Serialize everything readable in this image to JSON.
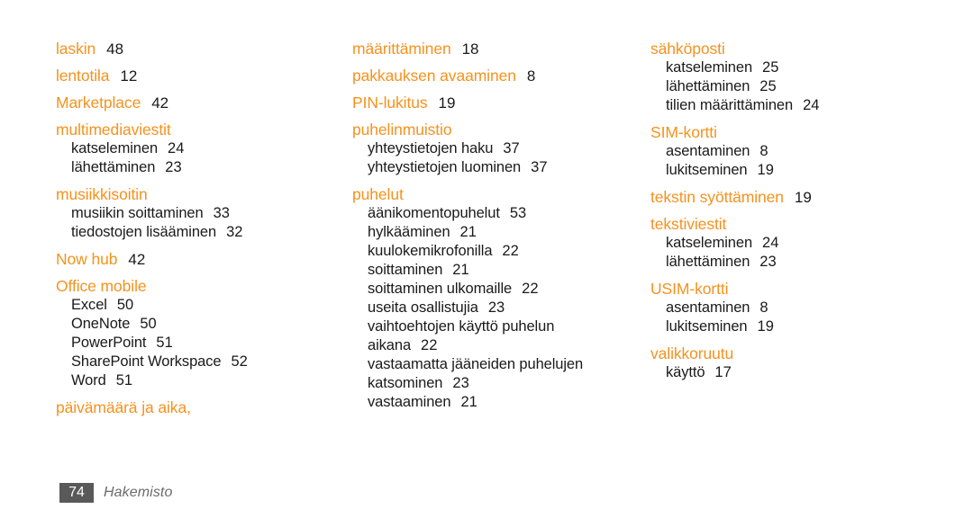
{
  "document": {
    "footer": {
      "page_number": "74",
      "section_label": "Hakemisto"
    },
    "accent_color": "#f5921e",
    "text_color": "#1a1a1a",
    "footer_box_color": "#595959"
  },
  "columns": [
    {
      "id": "column-1",
      "groups": [
        {
          "heading": "laskin",
          "heading_page": "48",
          "sub_entries": []
        },
        {
          "heading": "lentotila",
          "heading_page": "12",
          "sub_entries": []
        },
        {
          "heading": "Marketplace",
          "heading_page": "42",
          "sub_entries": []
        },
        {
          "heading": "multimediaviestit",
          "heading_page": "",
          "sub_entries": [
            {
              "label": "katseleminen",
              "page": "24"
            },
            {
              "label": "lähettäminen",
              "page": "23"
            }
          ]
        },
        {
          "heading": "musiikkisoitin",
          "heading_page": "",
          "sub_entries": [
            {
              "label": "musiikin soittaminen",
              "page": "33"
            },
            {
              "label": "tiedostojen lisääminen",
              "page": "32"
            }
          ]
        },
        {
          "heading": "Now hub",
          "heading_page": "42",
          "sub_entries": []
        },
        {
          "heading": "Office mobile",
          "heading_page": "",
          "sub_entries": [
            {
              "label": "Excel",
              "page": "50"
            },
            {
              "label": "OneNote",
              "page": "50"
            },
            {
              "label": "PowerPoint",
              "page": "51"
            },
            {
              "label": "SharePoint Workspace",
              "page": "52"
            },
            {
              "label": "Word",
              "page": "51"
            }
          ]
        },
        {
          "heading": "päivämäärä ja aika,",
          "heading_page": "",
          "sub_entries": []
        }
      ]
    },
    {
      "id": "column-2",
      "groups": [
        {
          "heading": "määrittäminen",
          "heading_page": "18",
          "sub_entries": []
        },
        {
          "heading": "pakkauksen avaaminen",
          "heading_page": "8",
          "sub_entries": []
        },
        {
          "heading": "PIN-lukitus",
          "heading_page": "19",
          "sub_entries": []
        },
        {
          "heading": "puhelinmuistio",
          "heading_page": "",
          "sub_entries": [
            {
              "label": "yhteystietojen haku",
              "page": "37"
            },
            {
              "label": "yhteystietojen luominen",
              "page": "37"
            }
          ]
        },
        {
          "heading": "puhelut",
          "heading_page": "",
          "sub_entries": [
            {
              "label": "äänikomentopuhelut",
              "page": "53"
            },
            {
              "label": "hylkääminen",
              "page": "21"
            },
            {
              "label": "kuulokemikrofonilla",
              "page": "22"
            },
            {
              "label": "soittaminen",
              "page": "21"
            },
            {
              "label": "soittaminen ulkomaille",
              "page": "22"
            },
            {
              "label": "useita osallistujia",
              "page": "23"
            },
            {
              "label": "vaihtoehtojen käyttö puhelun aikana",
              "page": "22",
              "wrapped": true
            },
            {
              "label": "vastaamatta jääneiden puhelujen katsominen",
              "page": "23",
              "wrapped": true
            },
            {
              "label": "vastaaminen",
              "page": "21"
            }
          ]
        }
      ]
    },
    {
      "id": "column-3",
      "groups": [
        {
          "heading": "sähköposti",
          "heading_page": "",
          "sub_entries": [
            {
              "label": "katseleminen",
              "page": "25"
            },
            {
              "label": "lähettäminen",
              "page": "25"
            },
            {
              "label": "tilien määrittäminen",
              "page": "24"
            }
          ]
        },
        {
          "heading": "SIM-kortti",
          "heading_page": "",
          "sub_entries": [
            {
              "label": "asentaminen",
              "page": "8"
            },
            {
              "label": "lukitseminen",
              "page": "19"
            }
          ]
        },
        {
          "heading": "tekstin syöttäminen",
          "heading_page": "19",
          "sub_entries": []
        },
        {
          "heading": "tekstiviestit",
          "heading_page": "",
          "sub_entries": [
            {
              "label": "katseleminen",
              "page": "24"
            },
            {
              "label": "lähettäminen",
              "page": "23"
            }
          ]
        },
        {
          "heading": "USIM-kortti",
          "heading_page": "",
          "sub_entries": [
            {
              "label": "asentaminen",
              "page": "8"
            },
            {
              "label": "lukitseminen",
              "page": "19"
            }
          ]
        },
        {
          "heading": "valikkoruutu",
          "heading_page": "",
          "sub_entries": [
            {
              "label": "käyttö",
              "page": "17"
            }
          ]
        }
      ]
    }
  ]
}
